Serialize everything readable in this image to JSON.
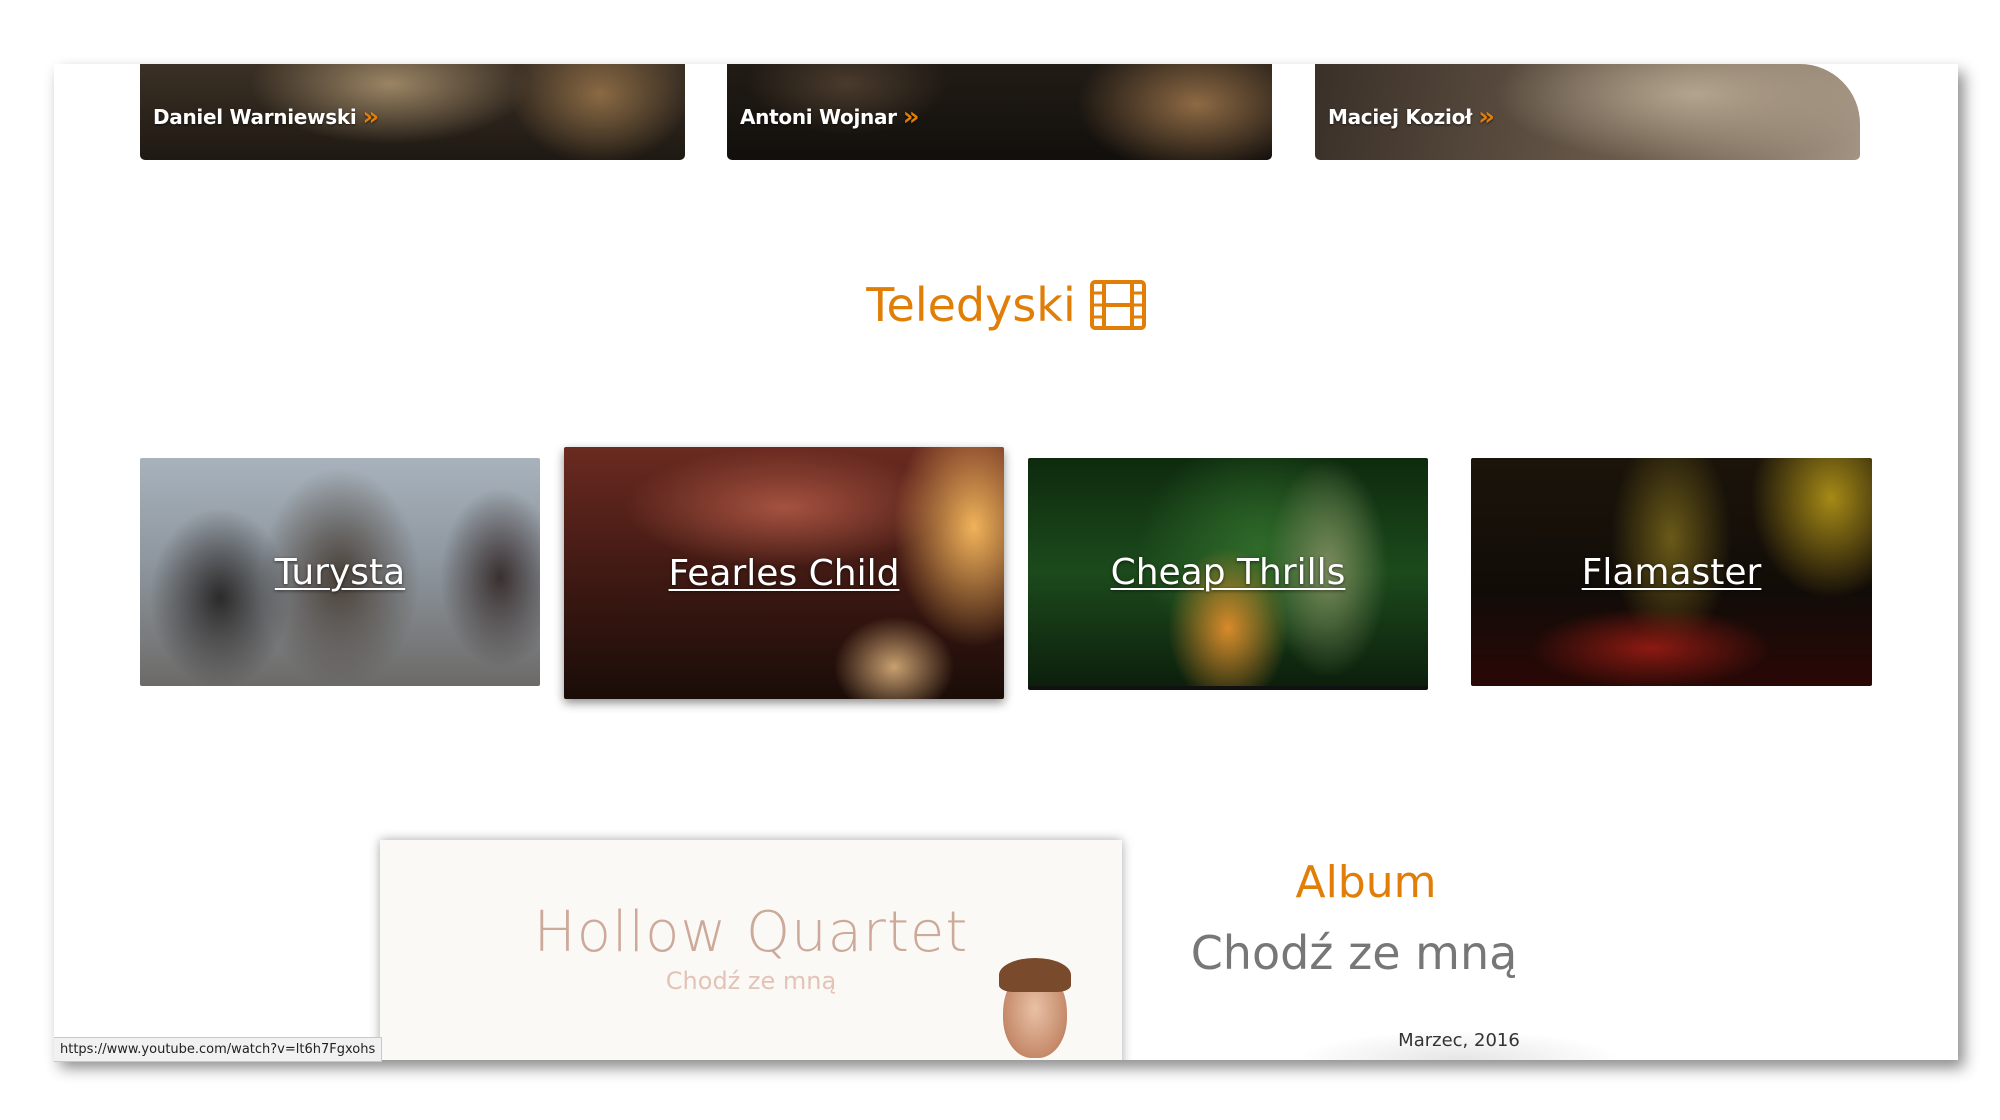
{
  "members": [
    {
      "name": "Daniel Warniewski",
      "arrow": "»"
    },
    {
      "name": "Antoni Wojnar",
      "arrow": "»"
    },
    {
      "name": "Maciej Kozioł",
      "arrow": "»"
    }
  ],
  "videos_section": {
    "title": "Teledyski",
    "icon": "film-icon",
    "items": [
      {
        "label": "Turysta"
      },
      {
        "label": "Fearles Child"
      },
      {
        "label": "Cheap Thrills"
      },
      {
        "label": "Flamaster"
      }
    ]
  },
  "album": {
    "heading": "Album",
    "title": "Chodź ze mną",
    "date": "Marzec, 2016",
    "cover_band": "Hollow Quartet",
    "cover_album": "Chodź ze mną"
  },
  "status_url": "https://www.youtube.com/watch?v=lt6h7Fgxohs",
  "colors": {
    "accent": "#e07e08",
    "heading_gray": "#777777"
  }
}
